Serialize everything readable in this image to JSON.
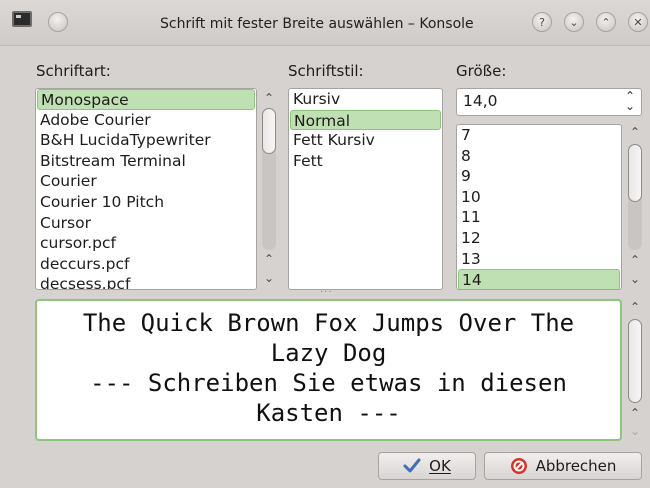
{
  "window": {
    "title": "Schrift mit fester Breite auswählen – Konsole",
    "help_glyph": "?",
    "minimize_glyph": "⌄",
    "maximize_glyph": "⌃",
    "close_glyph": "✕"
  },
  "font_family": {
    "label": "Schriftart:",
    "items": [
      "Monospace",
      "Adobe Courier",
      "B&H LucidaTypewriter",
      "Bitstream Terminal",
      "Courier",
      "Courier 10 Pitch",
      "Cursor",
      "cursor.pcf",
      "deccurs.pcf",
      "decsess.pcf"
    ],
    "selected": "Monospace"
  },
  "font_style": {
    "label": "Schriftstil:",
    "items": [
      "Kursiv",
      "Normal",
      "Fett Kursiv",
      "Fett"
    ],
    "selected": "Normal"
  },
  "font_size": {
    "label": "Größe:",
    "value": "14,0",
    "items": [
      "7",
      "8",
      "9",
      "10",
      "11",
      "12",
      "13",
      "14"
    ],
    "selected": "14"
  },
  "preview": {
    "line1": "The Quick Brown Fox Jumps Over The",
    "line2": "Lazy Dog",
    "line3": "--- Schreiben Sie etwas in diesen",
    "line4": "Kasten ---"
  },
  "buttons": {
    "ok_label": "OK",
    "cancel_label": "Abbrechen"
  },
  "colors": {
    "selection": "#bfe0b3",
    "focus_border": "#8fc47e",
    "cancel_icon": "#d8312a",
    "ok_icon": "#3f6fb5"
  }
}
